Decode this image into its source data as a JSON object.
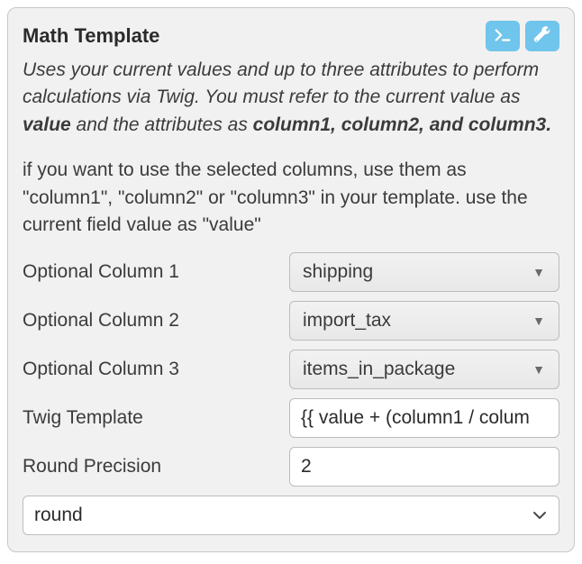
{
  "panel": {
    "title": "Math Template",
    "description_parts": {
      "p1": "Uses your current values and up to three attributes to perform calculations via Twig. You must refer to the current value as ",
      "b1": "value",
      "p2": " and the attributes as ",
      "b2": "column1, column2, and column3.",
      "end": ""
    },
    "hint": "if you want to use the selected columns, use them as \"column1\", \"column2\" or \"column3\" in your template. use the current field value as \"value\""
  },
  "fields": {
    "col1": {
      "label": "Optional Column 1",
      "value": "shipping"
    },
    "col2": {
      "label": "Optional Column 2",
      "value": "import_tax"
    },
    "col3": {
      "label": "Optional Column 3",
      "value": "items_in_package"
    },
    "twig": {
      "label": "Twig Template",
      "value": "{{ value + (column1 / colum"
    },
    "round_precision": {
      "label": "Round Precision",
      "value": "2"
    },
    "round_mode": {
      "value": "round"
    }
  },
  "icons": {
    "terminal": "terminal-icon",
    "wrench": "wrench-icon"
  }
}
